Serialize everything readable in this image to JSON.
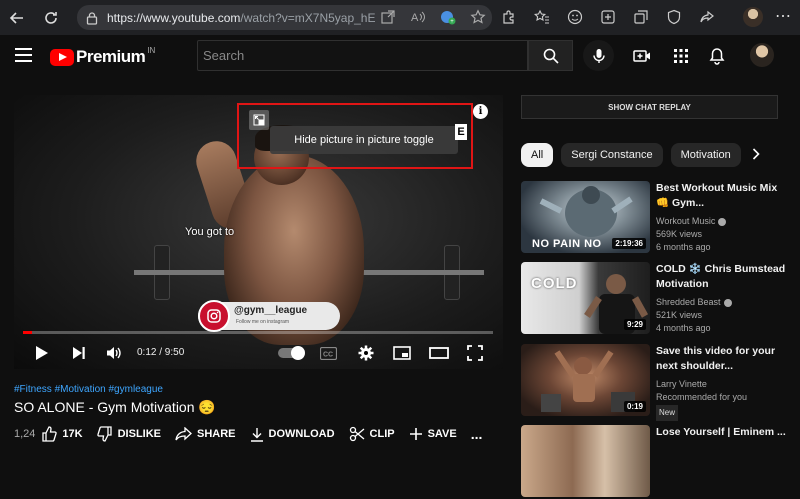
{
  "browser": {
    "url_host": "https://www.youtube.com",
    "url_path": "/watch?v=mX7N5yap_hE"
  },
  "header": {
    "logo_text": "Premium",
    "logo_region": "IN",
    "search_placeholder": "Search"
  },
  "player": {
    "subtitle": "You got to",
    "tooltip": "Hide picture in picture toggle",
    "rating_badge": "E",
    "info_label": "i",
    "ig_handle": "@gym__league",
    "ig_sub": "Follow me on instagram",
    "time_display": "0:12 / 9:50",
    "progress_fraction": 0.02
  },
  "video": {
    "hashtags": "#Fitness #Motivation #gymleague",
    "title": "SO ALONE - Gym Motivation 😔",
    "partial_count": "1,24",
    "like_count": "17K",
    "dislike_label": "DISLIKE",
    "share_label": "SHARE",
    "download_label": "DOWNLOAD",
    "clip_label": "CLIP",
    "save_label": "SAVE",
    "more_label": "..."
  },
  "sidebar": {
    "chat_replay_label": "SHOW CHAT REPLAY",
    "chips": [
      "All",
      "Sergi Constance",
      "Motivation"
    ],
    "recommendations": [
      {
        "title": "Best Workout Music Mix 👊 Gym...",
        "channel": "Workout Music",
        "views": "569K views",
        "age": "6 months ago",
        "duration": "2:19:36",
        "thumb_text": "NO PAIN NO"
      },
      {
        "title": "COLD ❄️ Chris Bumstead Motivation",
        "channel": "Shredded Beast",
        "views": "521K views",
        "age": "4 months ago",
        "duration": "9:29",
        "thumb_text": "COLD"
      },
      {
        "title": "Save this video for your next shoulder...",
        "channel": "Larry Vinette",
        "views": "Recommended for you",
        "age": "",
        "badge": "New",
        "duration": "0:19",
        "thumb_text": ""
      },
      {
        "title": "Lose Yourself | Eminem ...",
        "channel": "",
        "views": "",
        "age": "",
        "duration": "",
        "thumb_text": ""
      }
    ]
  }
}
